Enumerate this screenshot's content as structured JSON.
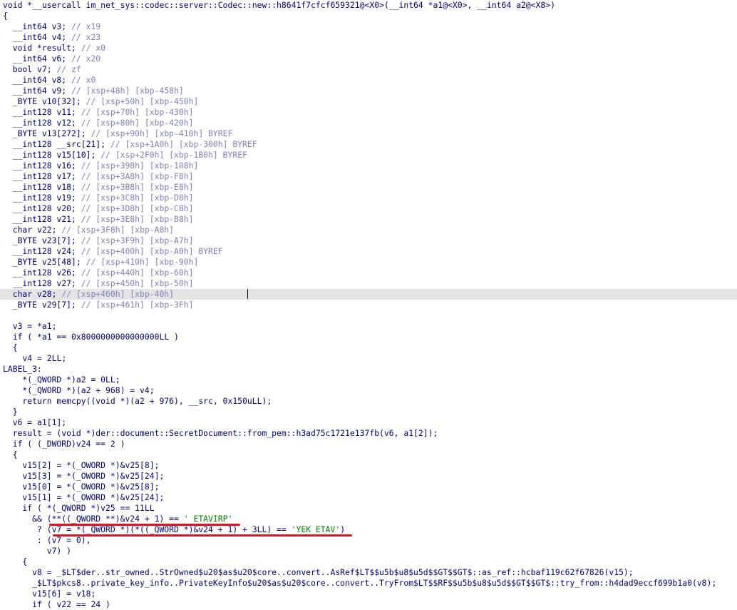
{
  "editor": {
    "lines": [
      {
        "text": "void *__usercall im_net_sys::codec::server::Codec::new::h8641f7cfcf659321@<X0>(__int64 *a1@<X0>, __int64 a2@<X8>)"
      },
      {
        "text": "{"
      },
      {
        "text": "  __int64 v3; // x19"
      },
      {
        "text": "  __int64 v4; // x23"
      },
      {
        "text": "  void *result; // x0"
      },
      {
        "text": "  __int64 v6; // x20"
      },
      {
        "text": "  bool v7; // zf"
      },
      {
        "text": "  __int64 v8; // x0"
      },
      {
        "text": "  __int64 v9; // [xsp+48h] [xbp-458h]"
      },
      {
        "text": "  _BYTE v10[32]; // [xsp+50h] [xbp-450h]"
      },
      {
        "text": "  __int128 v11; // [xsp+70h] [xbp-430h]"
      },
      {
        "text": "  __int128 v12; // [xsp+80h] [xbp-420h]"
      },
      {
        "text": "  _BYTE v13[272]; // [xsp+90h] [xbp-410h] BYREF"
      },
      {
        "text": "  __int128 __src[21]; // [xsp+1A0h] [xbp-300h] BYREF"
      },
      {
        "text": "  __int128 v15[10]; // [xsp+2F0h] [xbp-1B0h] BYREF"
      },
      {
        "text": "  __int128 v16; // [xsp+398h] [xbp-108h]"
      },
      {
        "text": "  __int128 v17; // [xsp+3A8h] [xbp-F8h]"
      },
      {
        "text": "  __int128 v18; // [xsp+3B8h] [xbp-E8h]"
      },
      {
        "text": "  __int128 v19; // [xsp+3C8h] [xbp-D8h]"
      },
      {
        "text": "  __int128 v20; // [xsp+3D8h] [xbp-C8h]"
      },
      {
        "text": "  __int128 v21; // [xsp+3E8h] [xbp-B8h]"
      },
      {
        "text": "  char v22; // [xsp+3F8h] [xbp-A8h]"
      },
      {
        "text": "  _BYTE v23[7]; // [xsp+3F9h] [xbp-A7h]"
      },
      {
        "text": "  __int128 v24; // [xsp+400h] [xbp-A0h] BYREF"
      },
      {
        "text": "  _BYTE v25[48]; // [xsp+410h] [xbp-90h]"
      },
      {
        "text": "  __int128 v26; // [xsp+440h] [xbp-60h]"
      },
      {
        "text": "  __int128 v27; // [xsp+450h] [xbp-50h]"
      },
      {
        "text": "  char v28; // [xsp+460h] [xbp-40h]",
        "highlight": true
      },
      {
        "text": "  _BYTE v29[7]; // [xsp+461h] [xbp-3Fh]"
      },
      {
        "text": ""
      },
      {
        "text": "  v3 = *a1;"
      },
      {
        "text": "  if ( *a1 == 0x8000000000000000LL )"
      },
      {
        "text": "  {"
      },
      {
        "text": "    v4 = 2LL;"
      },
      {
        "text": "LABEL_3:"
      },
      {
        "text": "    *(_QWORD *)a2 = 0LL;"
      },
      {
        "text": "    *(_QWORD *)(a2 + 968) = v4;"
      },
      {
        "text": "    return memcpy((void *)(a2 + 976), __src, 0x150uLL);"
      },
      {
        "text": "  }"
      },
      {
        "text": "  v6 = a1[1];"
      },
      {
        "text": "  result = (void *)der::document::SecretDocument::from_pem::h3ad75c1721e137fb(v6, a1[2]);"
      },
      {
        "text": "  if ( (_DWORD)v24 == 2 )"
      },
      {
        "text": "  {"
      },
      {
        "text": "    v15[2] = *(_OWORD *)&v25[8];"
      },
      {
        "text": "    v15[3] = *(_OWORD *)&v25[24];"
      },
      {
        "text": "    v15[0] = *(_OWORD *)&v25[8];"
      },
      {
        "text": "    v15[1] = *(_OWORD *)&v25[24];"
      },
      {
        "text": "    if ( *(_QWORD *)v25 == 11LL"
      },
      {
        "text": "      && (**((_QWORD **)&v24 + 1) == ' ETAVIRP'"
      },
      {
        "text": "       ? (v7 = *(_QWORD *)(*((_QWORD *)&v24 + 1) + 3LL) == 'YEK ETAV')"
      },
      {
        "text": "       : (v7 = 0),"
      },
      {
        "text": "         v7) )"
      },
      {
        "text": "    {"
      },
      {
        "text": "      v8 = _$LT$der..str_owned..StrOwned$u20$as$u20$core..convert..AsRef$LT$$u5b$u8$u5d$$GT$$GT$::as_ref::hcbaf119c62f67826(v15);"
      },
      {
        "text": "      _$LT$pkcs8..private_key_info..PrivateKeyInfo$u20$as$u20$core..convert..TryFrom$LT$$RF$$u5b$u8$u5d$$GT$$GT$::try_from::h4dad9eccf699b1a0(v8);"
      },
      {
        "text": "      v15[6] = v18;"
      },
      {
        "text": "      if ( v22 == 24 )"
      }
    ]
  }
}
